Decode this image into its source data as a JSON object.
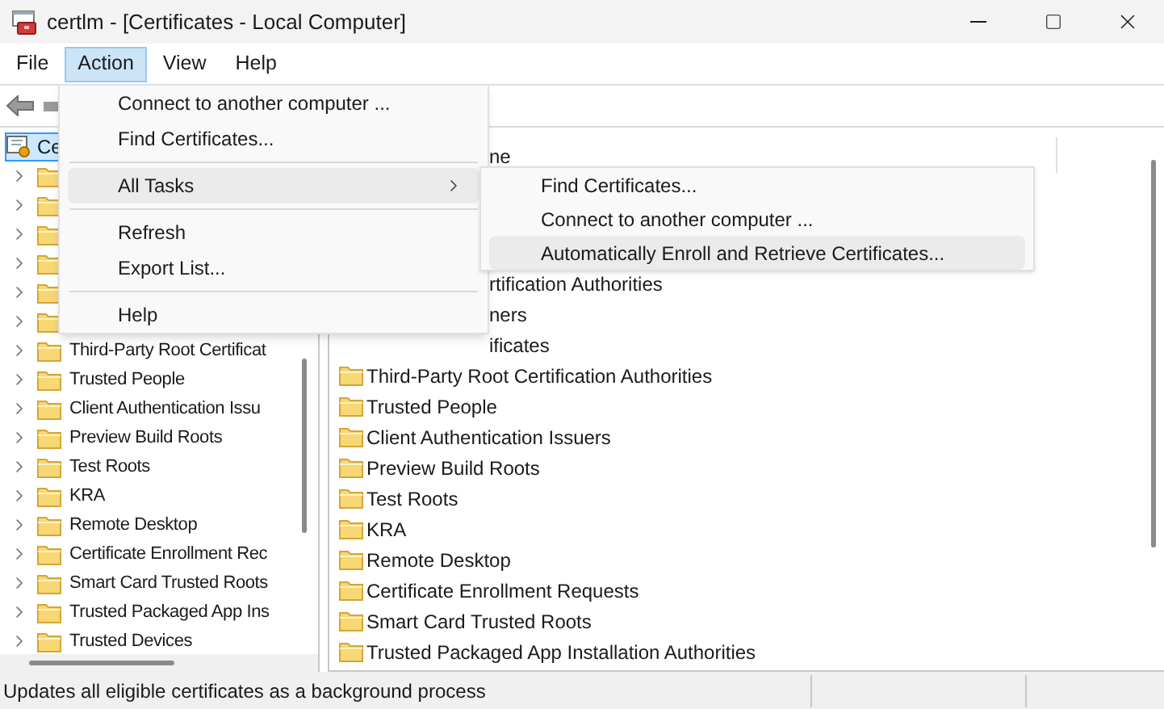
{
  "window": {
    "title": "certlm - [Certificates - Local Computer]"
  },
  "menu_bar": [
    {
      "label": "File",
      "selected": false
    },
    {
      "label": "Action",
      "selected": true
    },
    {
      "label": "View",
      "selected": false
    },
    {
      "label": "Help",
      "selected": false
    }
  ],
  "action_menu": [
    {
      "kind": "item",
      "label": "Connect to another computer ...",
      "selected": false
    },
    {
      "kind": "item",
      "label": "Find Certificates...",
      "selected": false
    },
    {
      "kind": "separator"
    },
    {
      "kind": "submenu",
      "label": "All Tasks",
      "selected": true
    },
    {
      "kind": "separator"
    },
    {
      "kind": "item",
      "label": "Refresh",
      "selected": false
    },
    {
      "kind": "item",
      "label": "Export List...",
      "selected": false
    },
    {
      "kind": "separator"
    },
    {
      "kind": "item",
      "label": "Help",
      "selected": false
    }
  ],
  "submenu": [
    {
      "label": "Find Certificates...",
      "selected": false
    },
    {
      "label": "Connect to another computer ...",
      "selected": false
    },
    {
      "label": "Automatically Enroll and Retrieve Certificates...",
      "selected": true
    }
  ],
  "tree": {
    "root": {
      "label": "Ce",
      "selected": true
    },
    "items": [
      {
        "expanded": false
      },
      {
        "expanded": false
      },
      {
        "expanded": false
      },
      {
        "expanded": false
      },
      {
        "expanded": false
      },
      {
        "expanded": false
      },
      {
        "label": "Third-Party Root Certificat",
        "expanded": false
      },
      {
        "label": "Trusted People",
        "expanded": false
      },
      {
        "label": "Client Authentication Issu",
        "expanded": false
      },
      {
        "label": "Preview Build Roots",
        "expanded": false
      },
      {
        "label": "Test Roots",
        "expanded": false
      },
      {
        "label": "KRA",
        "expanded": false
      },
      {
        "label": "Remote Desktop",
        "expanded": false
      },
      {
        "label": "Certificate Enrollment Rec",
        "expanded": false
      },
      {
        "label": "Smart Card Trusted Roots",
        "expanded": false
      },
      {
        "label": "Trusted Packaged App Ins",
        "expanded": false
      },
      {
        "label": "Trusted Devices",
        "expanded": false
      }
    ]
  },
  "list": {
    "column": "ne",
    "rows": [
      {
        "kind": "covered"
      },
      {
        "kind": "covered"
      },
      {
        "kind": "covered"
      },
      {
        "kind": "partial",
        "label": "rtification Authorities"
      },
      {
        "kind": "partial",
        "label": "ners"
      },
      {
        "kind": "partial",
        "label": "ificates"
      },
      {
        "kind": "full",
        "label": "Third-Party Root Certification Authorities"
      },
      {
        "kind": "full",
        "label": "Trusted People"
      },
      {
        "kind": "full",
        "label": "Client Authentication Issuers"
      },
      {
        "kind": "full",
        "label": "Preview Build Roots"
      },
      {
        "kind": "full",
        "label": "Test Roots"
      },
      {
        "kind": "full",
        "label": "KRA"
      },
      {
        "kind": "full",
        "label": "Remote Desktop"
      },
      {
        "kind": "full",
        "label": "Certificate Enrollment Requests"
      },
      {
        "kind": "full",
        "label": "Smart Card Trusted Roots"
      },
      {
        "kind": "full",
        "label": "Trusted Packaged App Installation Authorities"
      }
    ]
  },
  "status_bar": {
    "text": "Updates all eligible certificates as a background process"
  }
}
